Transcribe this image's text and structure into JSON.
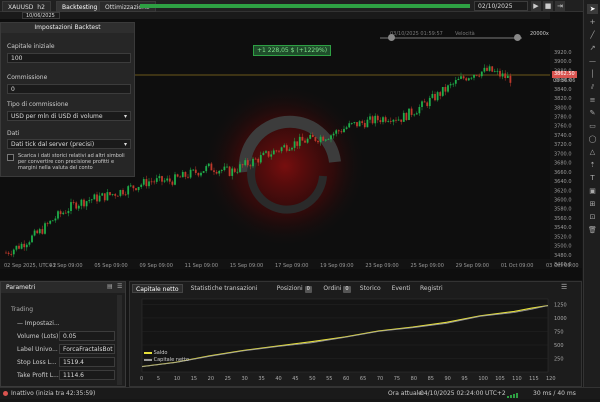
{
  "topbar": {
    "symbol": "XAUUSD",
    "timeframe": "h2",
    "tab_backtesting": "Backtesting",
    "tab_optimization": "Ottimizzazione",
    "end_date": "02/10/2025",
    "from_date": "10/06/2025",
    "speed_label": "Velocità",
    "speed_value": "20000x",
    "cursor_time": "03/10/2025 01:59:57"
  },
  "profit_badge": "+1 228,05 $ (+1229%)",
  "price": {
    "current": "3862.50",
    "current_time": "03:36:06",
    "levels": [
      "3920.0",
      "3900.0",
      "3880.0",
      "3860.0",
      "3840.0",
      "3820.0",
      "3800.0",
      "3780.0",
      "3760.0",
      "3740.0",
      "3720.0",
      "3700.0",
      "3680.0",
      "3660.0",
      "3640.0",
      "3620.0",
      "3600.0",
      "3580.0",
      "3560.0",
      "3540.0",
      "3520.0",
      "3500.0",
      "3480.0",
      "3460.0"
    ]
  },
  "time_axis": [
    "02 Sep 2025, UTC+2",
    "03 Sep 09:00",
    "05 Sep 09:00",
    "09 Sep 09:00",
    "11 Sep 09:00",
    "15 Sep 09:00",
    "17 Sep 09:00",
    "19 Sep 09:00",
    "23 Sep 09:00",
    "25 Sep 09:00",
    "29 Sep 09:00",
    "01 Oct 09:00",
    "03 Oct 09:00"
  ],
  "settings": {
    "title": "Impostazioni Backtest",
    "capital_label": "Capitale iniziale",
    "capital_value": "100",
    "commission_label": "Commissione",
    "commission_value": "0",
    "commission_type_label": "Tipo di commissione",
    "commission_type_value": "USD per mln di USD di volume",
    "data_label": "Dati",
    "data_value": "Dati tick dal server (precisi)",
    "checkbox_text": "Scarica i dati storici relativi ad altri simboli per convertire con precisione profitti e margini nella valuta del conto"
  },
  "params": {
    "title": "Parametri",
    "group": "Trading",
    "rows": [
      {
        "label": "— Impostazi...",
        "value": ""
      },
      {
        "label": "Volume (Lots)",
        "value": "0.05"
      },
      {
        "label": "Label Univo...",
        "value": "ForcaFractalsBot"
      },
      {
        "label": "Stop Loss L...",
        "value": "1519.4"
      },
      {
        "label": "Take Profit L...",
        "value": "1114.6"
      }
    ]
  },
  "bottom": {
    "tabs": [
      {
        "label": "Capitale netto",
        "badge": ""
      },
      {
        "label": "Statistiche transazioni",
        "badge": ""
      },
      {
        "label": "Posizioni",
        "badge": "0"
      },
      {
        "label": "Ordini",
        "badge": "0"
      },
      {
        "label": "Storico",
        "badge": ""
      },
      {
        "label": "Eventi",
        "badge": ""
      },
      {
        "label": "Registri",
        "badge": ""
      }
    ],
    "legend_balance": "Saldo",
    "legend_equity": "Capitale netto",
    "y_ticks": [
      "1250",
      "1000",
      "750",
      "500",
      "250"
    ],
    "x_ticks": [
      "0",
      "5",
      "10",
      "15",
      "20",
      "25",
      "30",
      "35",
      "40",
      "45",
      "50",
      "55",
      "60",
      "65",
      "70",
      "75",
      "80",
      "85",
      "90",
      "95",
      "100",
      "105",
      "110",
      "115",
      "120"
    ]
  },
  "equity_chart": {
    "type": "line",
    "x": [
      0,
      10,
      20,
      30,
      40,
      50,
      60,
      70,
      80,
      90,
      100,
      110,
      115,
      120
    ],
    "series": [
      {
        "name": "Saldo",
        "values": [
          100,
          180,
          300,
          400,
          480,
          560,
          650,
          760,
          830,
          920,
          1040,
          1120,
          1180,
          1228
        ]
      },
      {
        "name": "Capitale netto",
        "values": [
          100,
          175,
          290,
          390,
          470,
          540,
          640,
          750,
          820,
          900,
          1030,
          1100,
          1160,
          1228
        ]
      }
    ],
    "ylim": [
      0,
      1350
    ]
  },
  "status": {
    "state": "Inattivo (inizia tra 42:35:59)",
    "time_label": "Ora attuale:",
    "time_value": "04/10/2025 02:24:00",
    "tz": "UTC+2",
    "latency": "30 ms / 40 ms"
  },
  "colors": {
    "bull": "#1fae4a",
    "bear": "#c0392b",
    "accent": "#2ea043",
    "current_price": "#d9534f"
  }
}
